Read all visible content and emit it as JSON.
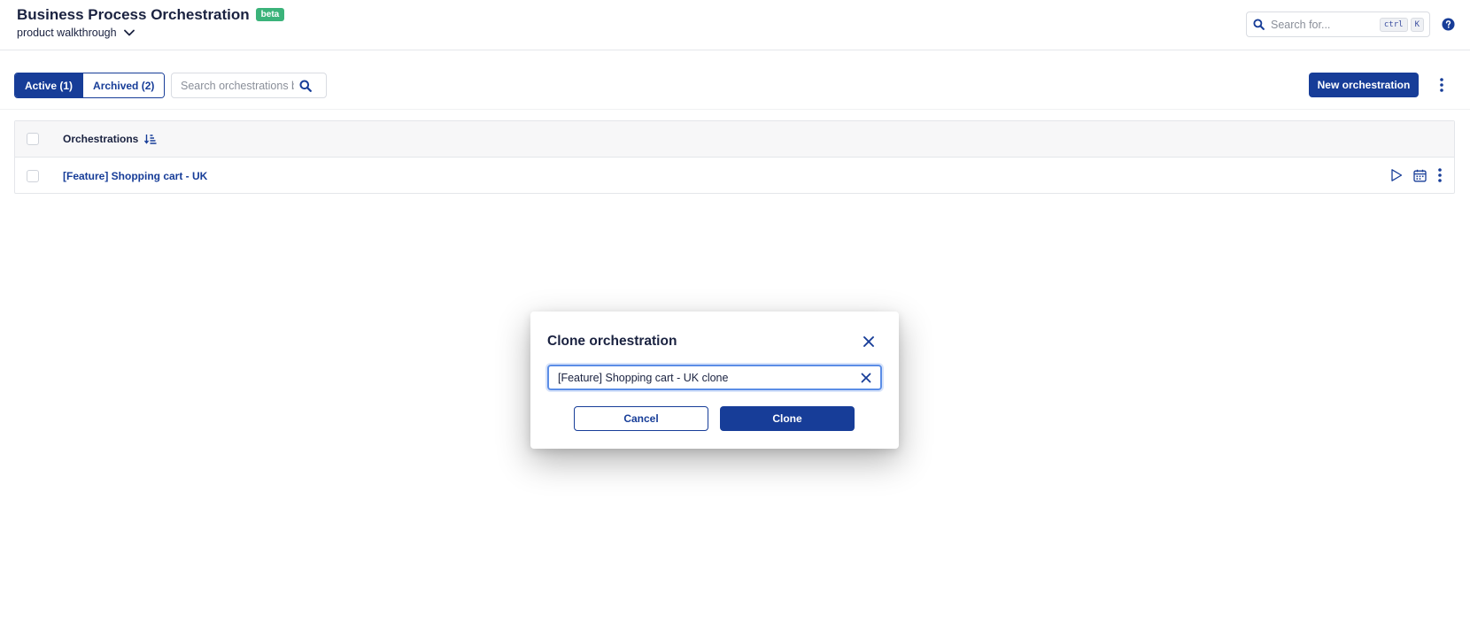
{
  "header": {
    "title": "Business Process Orchestration",
    "badge": "beta",
    "workspace": "product walkthrough",
    "search_placeholder": "Search for...",
    "shortcut_keys": [
      "ctrl",
      "K"
    ]
  },
  "toolbar": {
    "tabs": [
      {
        "label": "Active (1)",
        "active": true
      },
      {
        "label": "Archived (2)",
        "active": false
      }
    ],
    "search_placeholder": "Search orchestrations by name",
    "new_button_label": "New orchestration"
  },
  "table": {
    "column_header": "Orchestrations",
    "rows": [
      {
        "name": "[Feature] Shopping cart - UK"
      }
    ]
  },
  "dialog": {
    "title": "Clone orchestration",
    "name_value": "[Feature] Shopping cart - UK clone",
    "cancel_label": "Cancel",
    "confirm_label": "Clone"
  },
  "colors": {
    "primary": "#173d98",
    "badge": "#3bb37a",
    "focus": "#5b8de6"
  }
}
